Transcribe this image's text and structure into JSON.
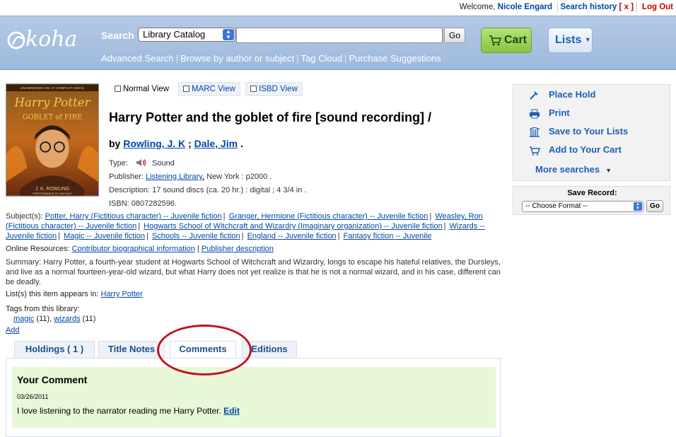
{
  "userbar": {
    "welcome_prefix": "Welcome, ",
    "user_name": "Nicole Engard",
    "search_history": "Search history",
    "search_history_clear": "[ x ]",
    "logout": "Log Out"
  },
  "header": {
    "logo_text": "koha",
    "search_label": "Search",
    "catalog_select": "Library Catalog",
    "search_value": "",
    "go": "Go",
    "cart": "Cart",
    "lists": "Lists",
    "links": [
      "Advanced Search",
      "Browse by author or subject",
      "Tag Cloud",
      "Purchase Suggestions"
    ]
  },
  "cover": {
    "top_text": "UNABRIDGED ON 17 COMPACT DISCS",
    "title_line1": "Harry Potter",
    "title_line2": "GOBLET of FIRE",
    "author": "J. K. ROWLING",
    "performer": "PERFORMANCE BY JIM DALE"
  },
  "view_tabs": [
    "Normal View",
    "MARC View",
    "ISBD View"
  ],
  "record": {
    "title": "Harry Potter and the goblet of fire [sound recording] /",
    "by": "by",
    "authors": [
      "Rowling, J. K",
      "Dale, Jim"
    ],
    "type_label": "Type:",
    "type_value": "Sound",
    "publisher_label": "Publisher:",
    "publisher_link": "Listening Library,",
    "publisher_rest": " New York : p2000 .",
    "description_label": "Description:",
    "description_value": "17 sound discs (ca. 20 hr.) : digital ; 4 3/4 in .",
    "isbn_label": "ISBN:",
    "isbn_value": "0807282596."
  },
  "subjects": {
    "label": "Subject(s):",
    "items": [
      "Potter, Harry (Fictitious character) -- Juvenile fiction",
      "Granger, Hermione (Fictitious character) -- Juvenile fiction",
      "Weasley, Ron (Fictitious character) -- Juvenile fiction",
      "Hogwarts School of Witchcraft and Wizardry (Imaginary organization) -- Juvenile fiction",
      "Wizards -- Juvenile fiction",
      "Magic -- Juvenile fiction",
      "Schools -- Juvenile fiction",
      "England -- Juvenile fiction",
      "Fantasy fiction -- Juvenile"
    ]
  },
  "online_resources": {
    "label": "Online Resources:",
    "links": [
      "Contributor biographical information",
      "Publisher description"
    ]
  },
  "summary": {
    "label": "Summary:",
    "text": "Harry Potter, a fourth-year student at Hogwarts School of Witchcraft and Wizardry, longs to escape his hateful relatives, the Dursleys, and live as a normal fourteen-year-old wizard, but what Harry does not yet realize is that he is not a normal wizard, and in his case, different can be deadly."
  },
  "lists_in": {
    "label": "List(s) this item appears in:",
    "link": "Harry Potter"
  },
  "tags": {
    "label": "Tags from this library:",
    "items": [
      {
        "name": "magic",
        "count": "(11)"
      },
      {
        "name": "wizards",
        "count": "(11)"
      }
    ],
    "add": "Add"
  },
  "tabs": [
    "Holdings ( 1 )",
    "Title Notes",
    "Comments",
    "Editions"
  ],
  "comment": {
    "heading": "Your Comment",
    "date": "03/26/2011",
    "text": "I love listening to the narrator reading me Harry Potter.",
    "edit": "Edit"
  },
  "actions": {
    "items": [
      "Place Hold",
      "Print",
      "Save to Your Lists",
      "Add to Your Cart"
    ],
    "more": "More searches"
  },
  "save_record": {
    "label": "Save Record:",
    "format": "-- Choose Format --",
    "go": "Go"
  },
  "colors": {
    "link": "#0047a6",
    "header_blue": "#a9c2e2",
    "cart_green": "#8ac43f",
    "highlight_red": "#c1121f",
    "comment_bg": "#e8f7d5"
  }
}
